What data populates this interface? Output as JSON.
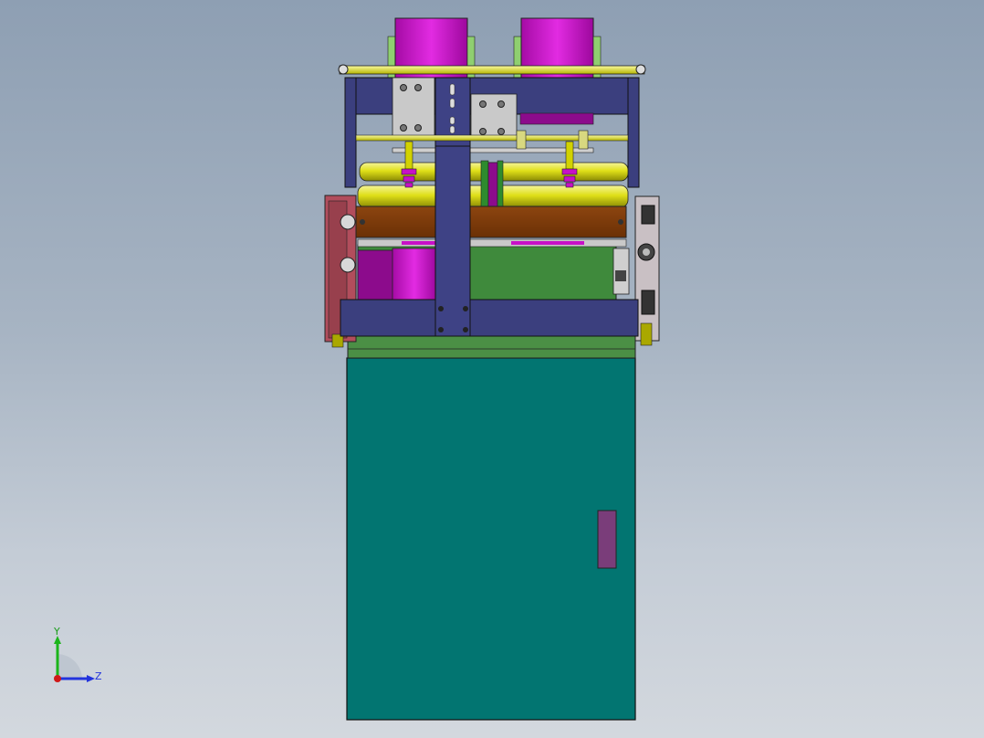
{
  "viewport": {
    "background_top": "#8e9fb3",
    "background_bottom": "#d3d8de"
  },
  "triad": {
    "y_label": "Y",
    "z_label": "Z"
  },
  "colors": {
    "cabinet": "#027571",
    "frame_blue": "#3b3f7e",
    "roller_magenta": "#c710c7",
    "roller_yellow": "#d8d80c",
    "wood": "#7d3b08",
    "green_panel": "#3f8a3c",
    "red_housing": "#b24d5c",
    "grey_plate": "#c9c9c9",
    "handle": "#7a3d7a"
  }
}
